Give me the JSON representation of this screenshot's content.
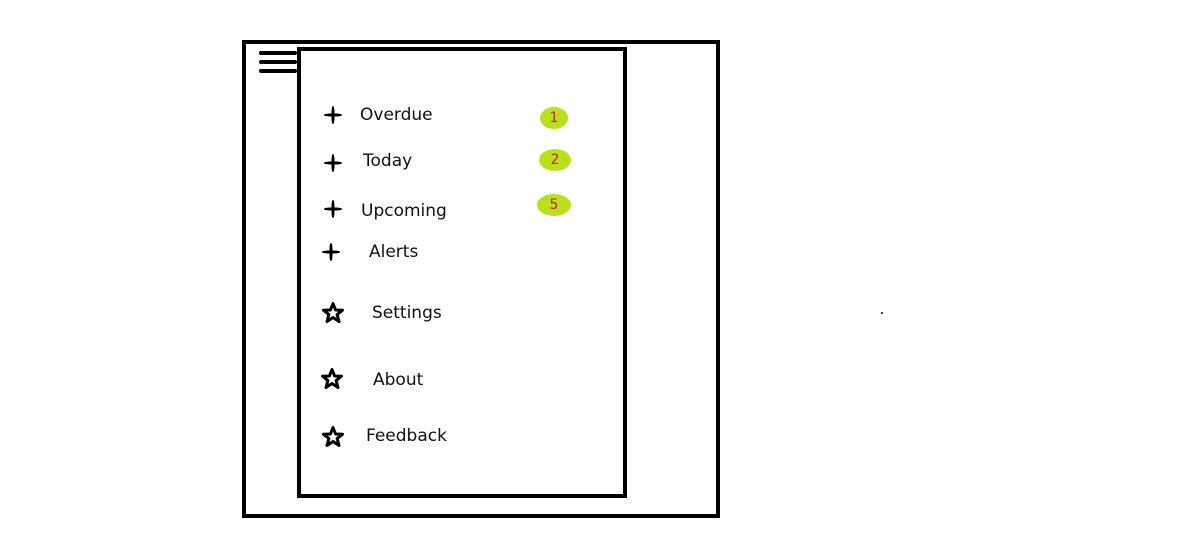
{
  "menu_button": {
    "icon": "hamburger-icon"
  },
  "drawer": {
    "items": [
      {
        "label": "Overdue",
        "icon": "plus-icon",
        "badge": "1"
      },
      {
        "label": "Today",
        "icon": "plus-icon",
        "badge": "2"
      },
      {
        "label": "Upcoming",
        "icon": "plus-icon",
        "badge": "5"
      },
      {
        "label": "Alerts",
        "icon": "plus-icon"
      },
      {
        "label": "Settings",
        "icon": "star-icon"
      },
      {
        "label": "About",
        "icon": "star-icon"
      },
      {
        "label": "Feedback",
        "icon": "star-icon"
      }
    ]
  },
  "colors": {
    "badge_fill": "#b9e11a",
    "badge_text": "#d01d1d",
    "frame": "#000000"
  }
}
